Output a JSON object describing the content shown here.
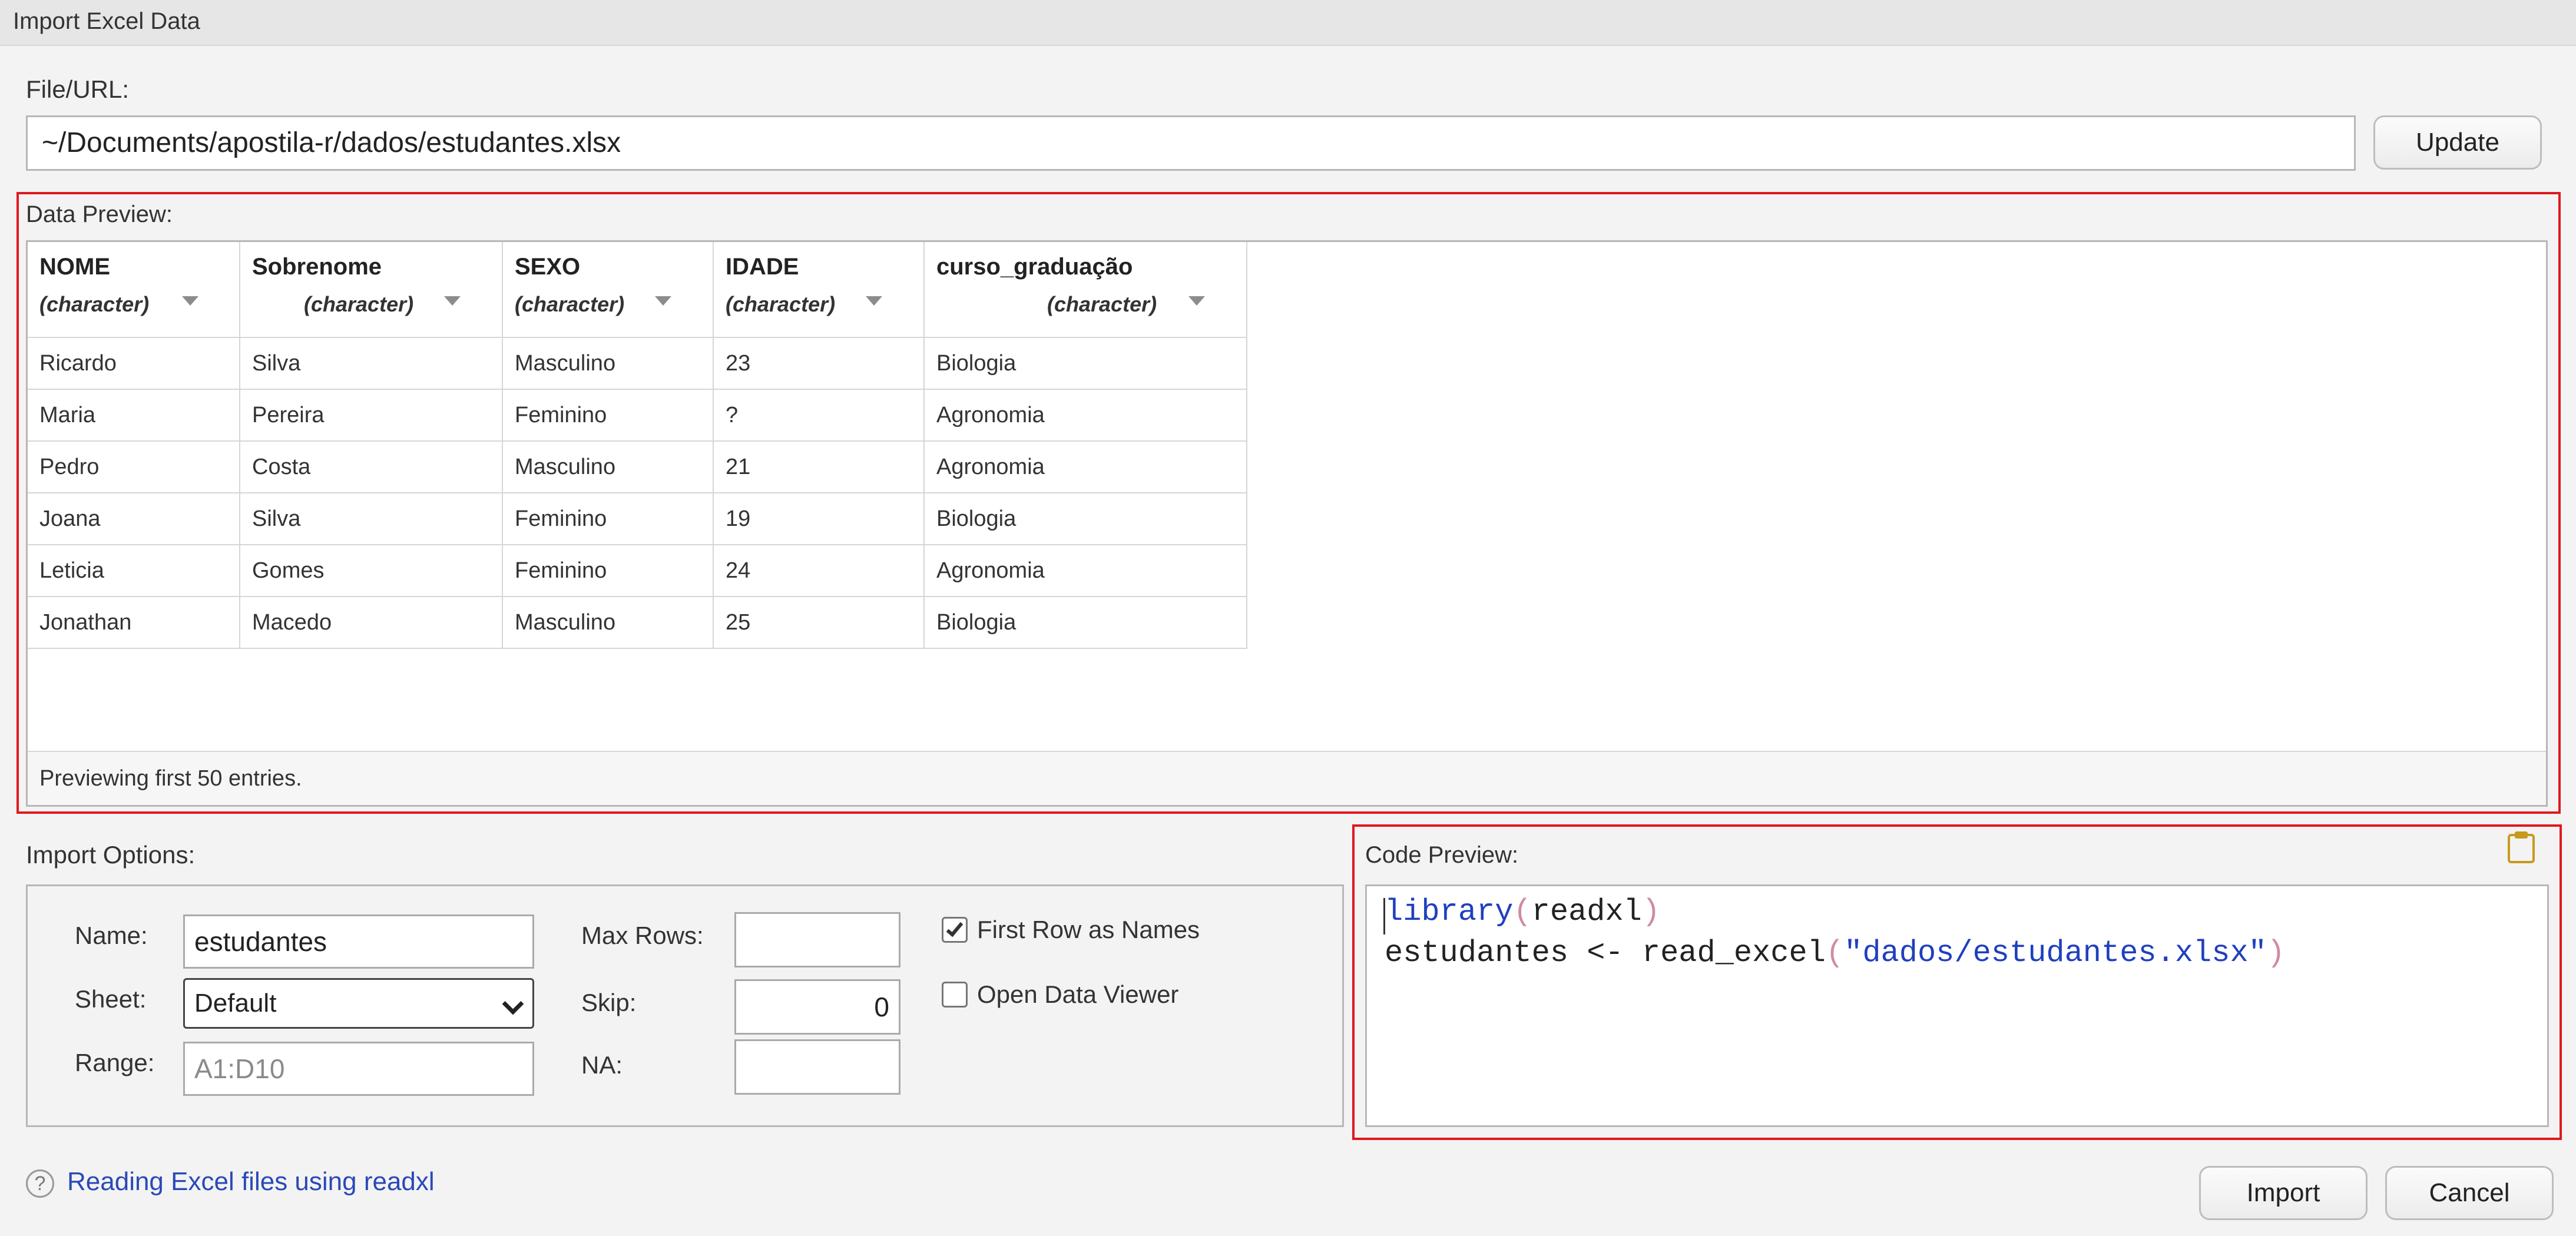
{
  "window": {
    "title": "Import Excel Data"
  },
  "file": {
    "label": "File/URL:",
    "value": "~/Documents/apostila-r/dados/estudantes.xlsx",
    "update_label": "Update"
  },
  "data_preview": {
    "label": "Data Preview:",
    "columns": [
      {
        "name": "NOME",
        "type": "(character)"
      },
      {
        "name": "Sobrenome",
        "type": "(character)"
      },
      {
        "name": "SEXO",
        "type": "(character)"
      },
      {
        "name": "IDADE",
        "type": "(character)"
      },
      {
        "name": "curso_graduação",
        "type": "(character)"
      }
    ],
    "rows": [
      [
        "Ricardo",
        "Silva",
        "Masculino",
        "23",
        "Biologia"
      ],
      [
        "Maria",
        "Pereira",
        "Feminino",
        "?",
        "Agronomia"
      ],
      [
        "Pedro",
        "Costa",
        "Masculino",
        "21",
        "Agronomia"
      ],
      [
        "Joana",
        "Silva",
        "Feminino",
        "19",
        "Biologia"
      ],
      [
        "Leticia",
        "Gomes",
        "Feminino",
        "24",
        "Agronomia"
      ],
      [
        "Jonathan",
        "Macedo",
        "Masculino",
        "25",
        "Biologia"
      ]
    ],
    "footer": "Previewing first 50 entries."
  },
  "import_options": {
    "label": "Import Options:",
    "name_label": "Name:",
    "name_value": "estudantes",
    "sheet_label": "Sheet:",
    "sheet_value": "Default",
    "range_label": "Range:",
    "range_placeholder": "A1:D10",
    "max_rows_label": "Max Rows:",
    "max_rows_value": "",
    "skip_label": "Skip:",
    "skip_value": "0",
    "na_label": "NA:",
    "na_value": "",
    "first_row_label": "First Row as Names",
    "first_row_checked": true,
    "open_viewer_label": "Open Data Viewer",
    "open_viewer_checked": false
  },
  "code_preview": {
    "label": "Code Preview:",
    "line1": {
      "fn": "library",
      "open": "(",
      "arg": "readxl",
      "close": ")"
    },
    "line2": {
      "lhs": "estudantes <- read_excel",
      "open": "(",
      "arg": "\"dados/estudantes.xlsx\"",
      "close": ")"
    }
  },
  "footer": {
    "help_icon": "?",
    "help_link": "Reading Excel files using readxl",
    "import_label": "Import",
    "cancel_label": "Cancel"
  },
  "colors": {
    "highlight": "#e0181f",
    "code_keyword": "#1f3fbf",
    "code_paren": "#d08aa4",
    "link": "#2a49b8"
  },
  "icons": [
    "clipboard-icon",
    "help-icon",
    "chevron-down-icon",
    "sort-caret-icon",
    "checkmark-icon"
  ]
}
